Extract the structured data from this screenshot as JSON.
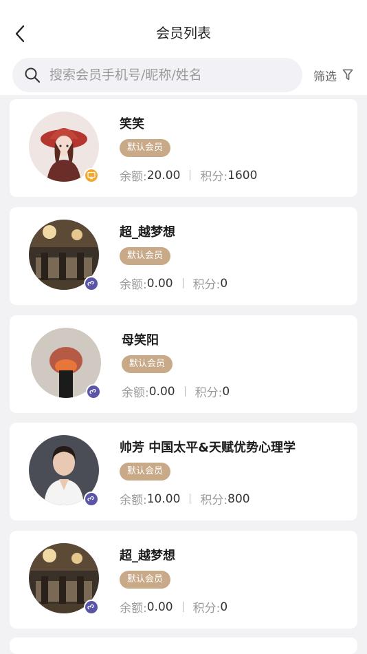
{
  "header": {
    "title": "会员列表",
    "back_icon": "chevron-left-icon"
  },
  "search": {
    "placeholder": "搜索会员手机号/昵称/姓名",
    "value": "",
    "icon": "search-icon"
  },
  "filter": {
    "label": "筛选",
    "icon": "filter-funnel-icon"
  },
  "colors": {
    "tag_bg": "#c8a988",
    "pc_badge": "#f2a830",
    "mini_badge": "#5a55a6",
    "background": "#f2f2f4"
  },
  "members": [
    {
      "name": "笑笑",
      "tag": "默认会员",
      "balance_label": "余额:",
      "balance": "20.00",
      "points_label": "积分:",
      "points": "1600",
      "source_icon": "desktop-icon"
    },
    {
      "name": "超_越梦想",
      "tag": "默认会员",
      "balance_label": "余额:",
      "balance": "0.00",
      "points_label": "积分:",
      "points": "0",
      "source_icon": "mini-program-icon"
    },
    {
      "name": "母笑阳",
      "tag": "默认会员",
      "balance_label": "余额:",
      "balance": "0.00",
      "points_label": "积分:",
      "points": "0",
      "source_icon": "mini-program-icon"
    },
    {
      "name": "帅芳 中国太平&天赋优势心理学",
      "tag": "默认会员",
      "balance_label": "余额:",
      "balance": "10.00",
      "points_label": "积分:",
      "points": "800",
      "source_icon": "mini-program-icon"
    },
    {
      "name": "超_越梦想",
      "tag": "默认会员",
      "balance_label": "余额:",
      "balance": "0.00",
      "points_label": "积分:",
      "points": "0",
      "source_icon": "mini-program-icon"
    }
  ]
}
